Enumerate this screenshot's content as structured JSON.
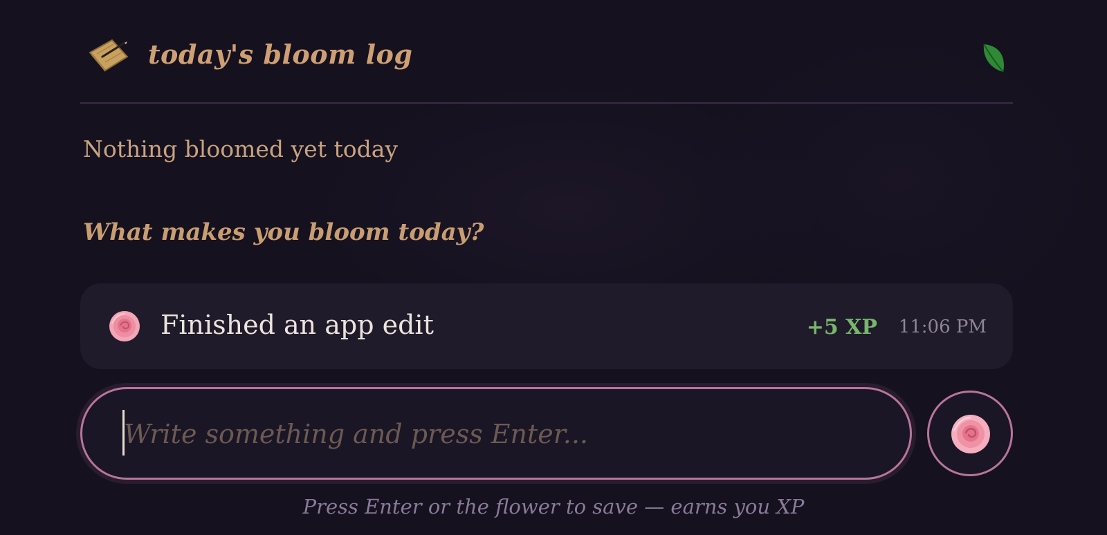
{
  "header": {
    "icon": "notebook-pencil-icon",
    "title": "today's bloom log",
    "status_icon": "leaf-icon"
  },
  "log": {
    "empty_message": "Nothing bloomed yet today",
    "prompt_heading": "What makes you bloom today?",
    "entries": [
      {
        "icon": "rose-icon",
        "text": "Finished an app edit",
        "xp": "+5 XP",
        "time": "11:06 PM"
      }
    ]
  },
  "composer": {
    "placeholder": "Write something and press Enter...",
    "value": "",
    "submit_icon": "rose-icon",
    "hint": "Press Enter or the flower to save — earns you XP"
  },
  "colors": {
    "background": "#15111f",
    "accent_text": "#cf9f74",
    "xp_green": "#79b66c",
    "border_pink": "#b7759c"
  }
}
